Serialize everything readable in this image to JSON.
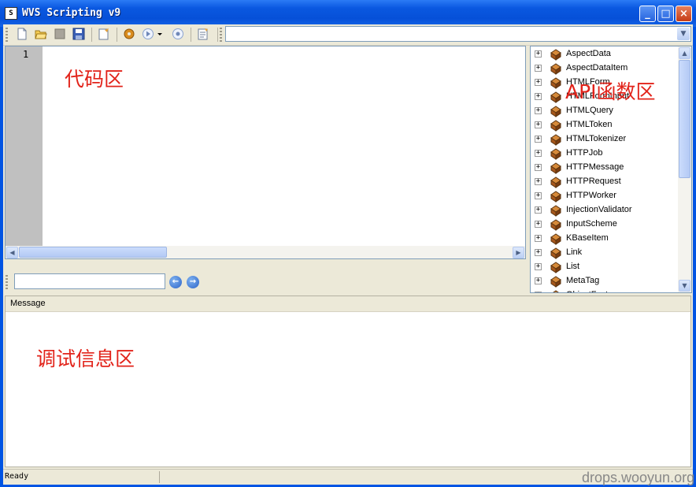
{
  "window": {
    "title": "WVS Scripting v9",
    "title_icon": "script-app-icon",
    "buttons": [
      {
        "name": "minimize-button",
        "glyph": "_"
      },
      {
        "name": "maximize-button",
        "glyph": "□"
      },
      {
        "name": "close-button",
        "glyph": "×"
      }
    ]
  },
  "toolbar": {
    "icons": [
      "new-file-icon",
      "open-folder-icon",
      "close-file-icon",
      "save-icon",
      "edit-script-icon",
      "settings-gear-icon",
      "run-icon",
      "stop-icon",
      "properties-icon"
    ],
    "combo_value": "",
    "combo_arrow": "▼"
  },
  "editor": {
    "line_numbers": [
      "1"
    ],
    "annotation": "代码区"
  },
  "findbar": {
    "search_value": "",
    "prev_glyph": "←",
    "next_glyph": "→"
  },
  "api_panel": {
    "annotation": "API函数区",
    "items": [
      "AspectData",
      "AspectDataItem",
      "HTMLForm",
      "HTMLFormInput",
      "HTMLQuery",
      "HTMLToken",
      "HTMLTokenizer",
      "HTTPJob",
      "HTTPMessage",
      "HTTPRequest",
      "HTTPWorker",
      "InjectionValidator",
      "InputScheme",
      "KBaseItem",
      "Link",
      "List",
      "MetaTag",
      "ObjectFactory"
    ]
  },
  "message_panel": {
    "header": "Message",
    "annotation": "调试信息区"
  },
  "status": {
    "text": "Ready"
  },
  "watermark": "drops.wooyun.org",
  "colors": {
    "titlebar": "#0a58e0",
    "annotation": "#e2231a",
    "face": "#ece9d8"
  }
}
